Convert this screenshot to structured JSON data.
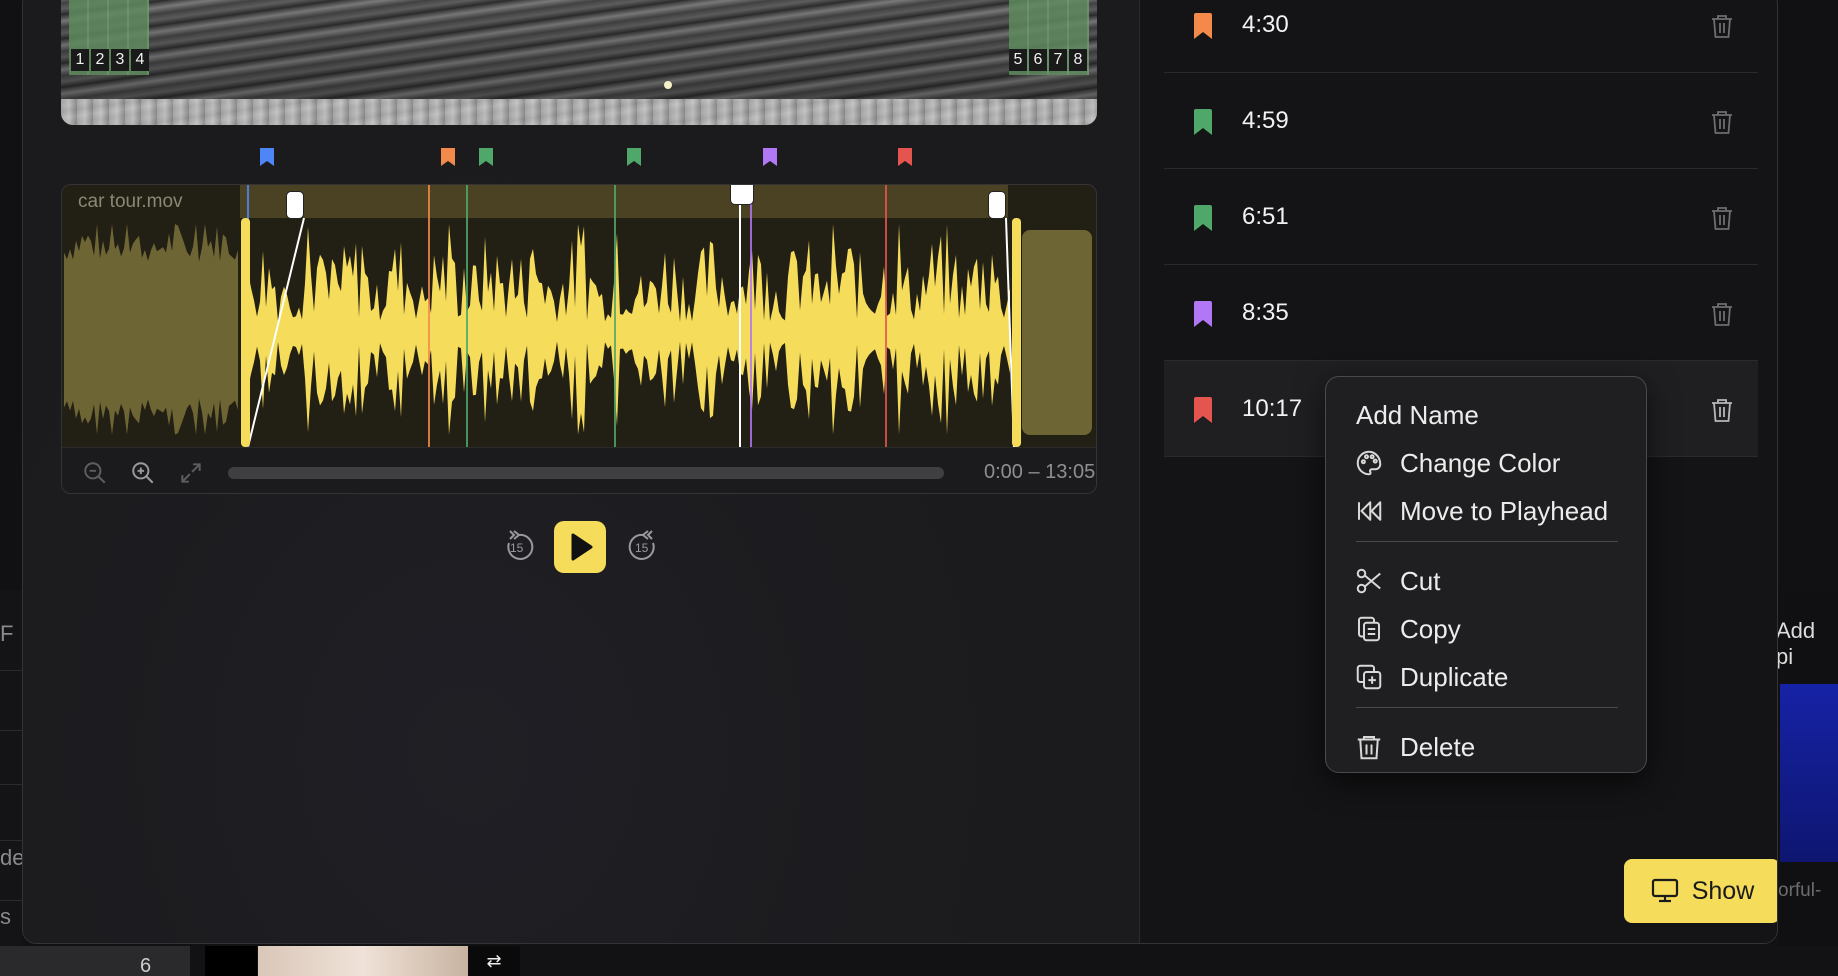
{
  "clip": {
    "name": "car tour.mov",
    "range_text": "0:00 – 13:05"
  },
  "thumb_numbers": {
    "left": [
      "1",
      "2",
      "3",
      "4"
    ],
    "right": [
      "5",
      "6",
      "7",
      "8"
    ]
  },
  "colors": {
    "blue": "#4f86f7",
    "orange": "#f3894a",
    "green": "#4fa86a",
    "purple": "#b277f5",
    "red": "#e4554f",
    "accent_yellow": "#f5dc5b"
  },
  "timeline_flags": [
    "blue",
    "orange",
    "green",
    "green",
    "purple",
    "red"
  ],
  "markers": [
    {
      "time": "4:30",
      "color": "orange"
    },
    {
      "time": "4:59",
      "color": "green"
    },
    {
      "time": "6:51",
      "color": "green"
    },
    {
      "time": "8:35",
      "color": "purple"
    },
    {
      "time": "10:17",
      "color": "red",
      "selected": true
    }
  ],
  "transport": {
    "skip_back_label": "15",
    "skip_forward_label": "15"
  },
  "context_menu": {
    "items": [
      {
        "label": "Add Name",
        "icon": "none"
      },
      {
        "label": "Change Color",
        "icon": "palette-icon"
      },
      {
        "label": "Move to Playhead",
        "icon": "skip-back-icon"
      },
      {
        "label": "Cut",
        "icon": "scissors-icon"
      },
      {
        "label": "Copy",
        "icon": "copy-icon"
      },
      {
        "label": "Duplicate",
        "icon": "duplicate-icon"
      },
      {
        "label": "Delete",
        "icon": "trash-icon"
      }
    ]
  },
  "show_button": {
    "label": "Show",
    "icon": "monitor-icon"
  },
  "background": {
    "left_labels": [
      "F",
      "de",
      "s"
    ],
    "right_label": "Add pi",
    "right_caption": "orful-",
    "bottom_number": "6"
  }
}
